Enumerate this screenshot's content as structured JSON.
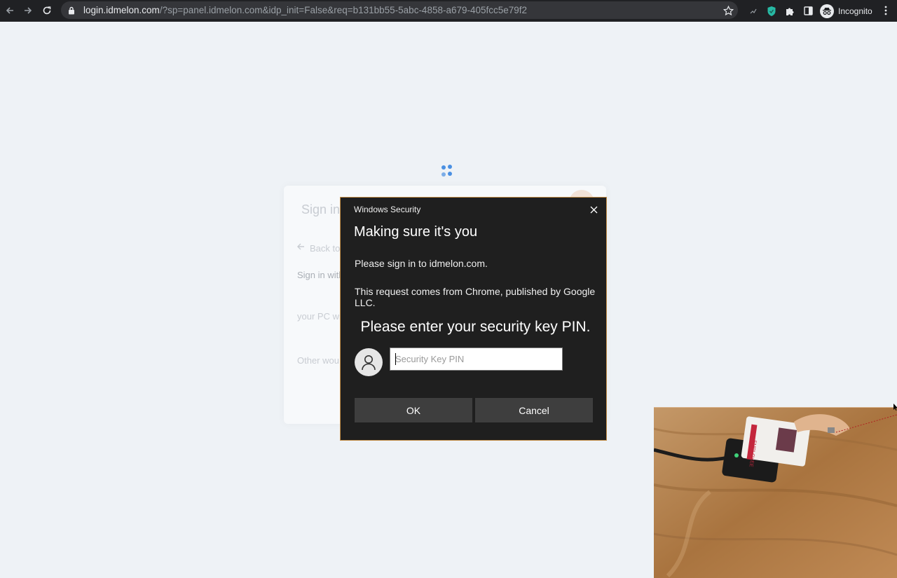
{
  "browser": {
    "url_host": "login.idmelon.com",
    "url_rest": "/?sp=panel.idmelon.com&idp_init=False&req=b131bb55-5abc-4858-a679-405fcc5e79f2",
    "incognito_label": "Incognito",
    "icons": [
      "back-icon",
      "forward-icon",
      "reload-icon",
      "lock-icon",
      "star-icon",
      "extension-icon",
      "shield-icon",
      "puzzle-icon",
      "sidepanel-icon",
      "incognito-icon",
      "more-icon"
    ]
  },
  "background_page": {
    "title": "Sign in",
    "back_link": "Back to",
    "line_sign_in_with": "Sign in with",
    "line_your_pc": "your PC wi",
    "line_other": "Other wou"
  },
  "dialog": {
    "caption": "Windows Security",
    "title": "Making sure it's you",
    "line1": "Please sign in to idmelon.com.",
    "line2": "This request comes from Chrome, published by Google LLC.",
    "prompt": "Please enter your security key PIN.",
    "pin_placeholder": "Security Key PIN",
    "pin_value": "",
    "ok_label": "OK",
    "cancel_label": "Cancel"
  },
  "webcam": {
    "badge_text": "EMPLOYEE"
  },
  "colors": {
    "chrome_bg": "#202124",
    "omnibox_bg": "#35363a",
    "page_bg": "#eef2f6",
    "dialog_bg": "#1f1f1f",
    "dialog_border": "#c58f48",
    "button_bg": "#3e3e3e",
    "spinner": "#4a90e2"
  }
}
